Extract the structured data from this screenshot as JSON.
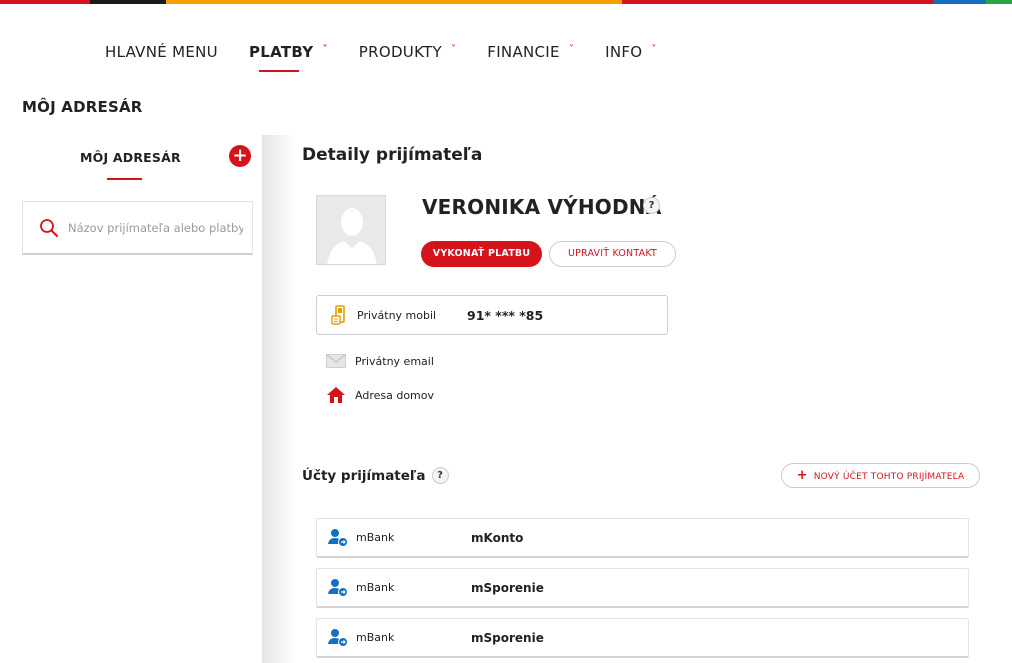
{
  "topbar_colors": [
    "#d4131b",
    "#1a1a1a",
    "#f4a000",
    "#d4131b",
    "#1570c3",
    "#2aa640"
  ],
  "nav": {
    "items": [
      {
        "label": "HLAVNÉ MENU",
        "chevron": false,
        "active": false
      },
      {
        "label": "PLATBY",
        "chevron": true,
        "active": true
      },
      {
        "label": "PRODUKTY",
        "chevron": true,
        "active": false
      },
      {
        "label": "FINANCIE",
        "chevron": true,
        "active": false
      },
      {
        "label": "INFO",
        "chevron": true,
        "active": false
      }
    ],
    "chevron_glyph": "˅"
  },
  "page_title": "MÔJ ADRESÁR",
  "sidebar": {
    "title": "MÔJ ADRESÁR",
    "add_glyph": "+",
    "search_placeholder": "Názov prijímateľa alebo platby"
  },
  "detail": {
    "title": "Detaily prijímateľa",
    "name": "VERONIKA VÝHODNÁ",
    "help_glyph": "?",
    "pay_button": "VYKONAŤ PLATBU",
    "edit_button": "UPRAVIŤ KONTAKT",
    "contacts": {
      "mobile_label": "Privátny mobil",
      "mobile_value": "91* *** *85",
      "email_label": "Privátny email",
      "address_label": "Adresa domov"
    }
  },
  "accounts": {
    "title": "Účty prijímateľa",
    "new_button": "NOVÝ ÚČET TOHTO PRIJÍMATEĽA",
    "plus_glyph": "+",
    "rows": [
      {
        "bank": "mBank",
        "name": "mKonto"
      },
      {
        "bank": "mBank",
        "name": "mSporenie"
      },
      {
        "bank": "mBank",
        "name": "mSporenie"
      }
    ]
  },
  "colors": {
    "accent": "#d4131b",
    "icon_blue": "#1570c3",
    "icon_gold": "#e0a000"
  }
}
